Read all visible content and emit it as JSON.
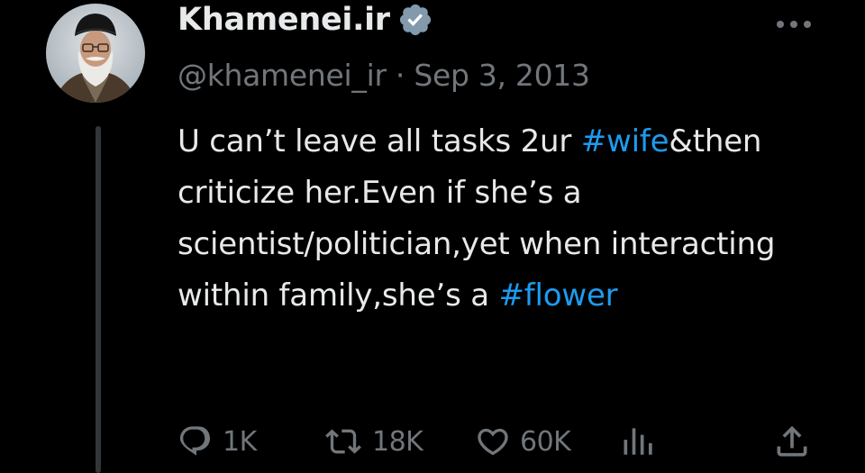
{
  "tweet": {
    "display_name": "Khamenei.ir",
    "handle": "@khamenei_ir",
    "separator": "·",
    "date": "Sep 3, 2013",
    "text_segments": [
      "U can’t leave all tasks 2ur ",
      "#wife",
      "&then criticize her.Even if she’s a scientist/politician,yet when interacting within family,she’s a ",
      "#flower"
    ],
    "stats": {
      "replies": "1K",
      "retweets": "18K",
      "likes": "60K"
    }
  },
  "colors": {
    "background": "#000000",
    "text": "#e7e9ea",
    "secondary": "#71767b",
    "accent": "#1d9bf0"
  },
  "icons": [
    "verified-badge-icon",
    "more-options-icon",
    "reply-icon",
    "retweet-icon",
    "like-icon",
    "views-icon",
    "share-icon"
  ]
}
